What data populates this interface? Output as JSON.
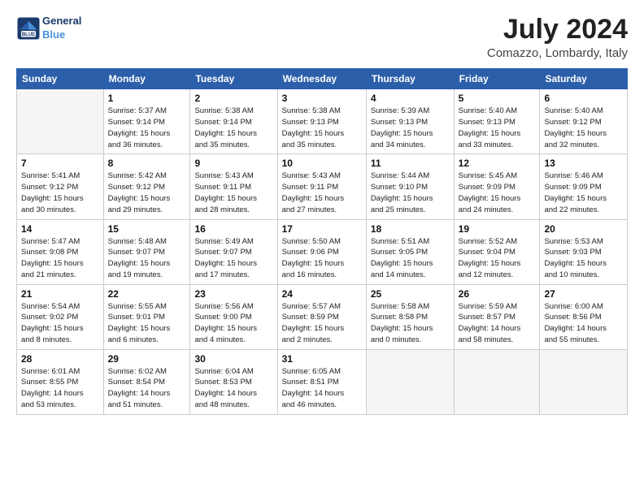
{
  "header": {
    "logo_line1": "General",
    "logo_line2": "Blue",
    "month": "July 2024",
    "location": "Comazzo, Lombardy, Italy"
  },
  "days_of_week": [
    "Sunday",
    "Monday",
    "Tuesday",
    "Wednesday",
    "Thursday",
    "Friday",
    "Saturday"
  ],
  "weeks": [
    [
      {
        "num": "",
        "info": ""
      },
      {
        "num": "1",
        "info": "Sunrise: 5:37 AM\nSunset: 9:14 PM\nDaylight: 15 hours\nand 36 minutes."
      },
      {
        "num": "2",
        "info": "Sunrise: 5:38 AM\nSunset: 9:14 PM\nDaylight: 15 hours\nand 35 minutes."
      },
      {
        "num": "3",
        "info": "Sunrise: 5:38 AM\nSunset: 9:13 PM\nDaylight: 15 hours\nand 35 minutes."
      },
      {
        "num": "4",
        "info": "Sunrise: 5:39 AM\nSunset: 9:13 PM\nDaylight: 15 hours\nand 34 minutes."
      },
      {
        "num": "5",
        "info": "Sunrise: 5:40 AM\nSunset: 9:13 PM\nDaylight: 15 hours\nand 33 minutes."
      },
      {
        "num": "6",
        "info": "Sunrise: 5:40 AM\nSunset: 9:12 PM\nDaylight: 15 hours\nand 32 minutes."
      }
    ],
    [
      {
        "num": "7",
        "info": "Sunrise: 5:41 AM\nSunset: 9:12 PM\nDaylight: 15 hours\nand 30 minutes."
      },
      {
        "num": "8",
        "info": "Sunrise: 5:42 AM\nSunset: 9:12 PM\nDaylight: 15 hours\nand 29 minutes."
      },
      {
        "num": "9",
        "info": "Sunrise: 5:43 AM\nSunset: 9:11 PM\nDaylight: 15 hours\nand 28 minutes."
      },
      {
        "num": "10",
        "info": "Sunrise: 5:43 AM\nSunset: 9:11 PM\nDaylight: 15 hours\nand 27 minutes."
      },
      {
        "num": "11",
        "info": "Sunrise: 5:44 AM\nSunset: 9:10 PM\nDaylight: 15 hours\nand 25 minutes."
      },
      {
        "num": "12",
        "info": "Sunrise: 5:45 AM\nSunset: 9:09 PM\nDaylight: 15 hours\nand 24 minutes."
      },
      {
        "num": "13",
        "info": "Sunrise: 5:46 AM\nSunset: 9:09 PM\nDaylight: 15 hours\nand 22 minutes."
      }
    ],
    [
      {
        "num": "14",
        "info": "Sunrise: 5:47 AM\nSunset: 9:08 PM\nDaylight: 15 hours\nand 21 minutes."
      },
      {
        "num": "15",
        "info": "Sunrise: 5:48 AM\nSunset: 9:07 PM\nDaylight: 15 hours\nand 19 minutes."
      },
      {
        "num": "16",
        "info": "Sunrise: 5:49 AM\nSunset: 9:07 PM\nDaylight: 15 hours\nand 17 minutes."
      },
      {
        "num": "17",
        "info": "Sunrise: 5:50 AM\nSunset: 9:06 PM\nDaylight: 15 hours\nand 16 minutes."
      },
      {
        "num": "18",
        "info": "Sunrise: 5:51 AM\nSunset: 9:05 PM\nDaylight: 15 hours\nand 14 minutes."
      },
      {
        "num": "19",
        "info": "Sunrise: 5:52 AM\nSunset: 9:04 PM\nDaylight: 15 hours\nand 12 minutes."
      },
      {
        "num": "20",
        "info": "Sunrise: 5:53 AM\nSunset: 9:03 PM\nDaylight: 15 hours\nand 10 minutes."
      }
    ],
    [
      {
        "num": "21",
        "info": "Sunrise: 5:54 AM\nSunset: 9:02 PM\nDaylight: 15 hours\nand 8 minutes."
      },
      {
        "num": "22",
        "info": "Sunrise: 5:55 AM\nSunset: 9:01 PM\nDaylight: 15 hours\nand 6 minutes."
      },
      {
        "num": "23",
        "info": "Sunrise: 5:56 AM\nSunset: 9:00 PM\nDaylight: 15 hours\nand 4 minutes."
      },
      {
        "num": "24",
        "info": "Sunrise: 5:57 AM\nSunset: 8:59 PM\nDaylight: 15 hours\nand 2 minutes."
      },
      {
        "num": "25",
        "info": "Sunrise: 5:58 AM\nSunset: 8:58 PM\nDaylight: 15 hours\nand 0 minutes."
      },
      {
        "num": "26",
        "info": "Sunrise: 5:59 AM\nSunset: 8:57 PM\nDaylight: 14 hours\nand 58 minutes."
      },
      {
        "num": "27",
        "info": "Sunrise: 6:00 AM\nSunset: 8:56 PM\nDaylight: 14 hours\nand 55 minutes."
      }
    ],
    [
      {
        "num": "28",
        "info": "Sunrise: 6:01 AM\nSunset: 8:55 PM\nDaylight: 14 hours\nand 53 minutes."
      },
      {
        "num": "29",
        "info": "Sunrise: 6:02 AM\nSunset: 8:54 PM\nDaylight: 14 hours\nand 51 minutes."
      },
      {
        "num": "30",
        "info": "Sunrise: 6:04 AM\nSunset: 8:53 PM\nDaylight: 14 hours\nand 48 minutes."
      },
      {
        "num": "31",
        "info": "Sunrise: 6:05 AM\nSunset: 8:51 PM\nDaylight: 14 hours\nand 46 minutes."
      },
      {
        "num": "",
        "info": ""
      },
      {
        "num": "",
        "info": ""
      },
      {
        "num": "",
        "info": ""
      }
    ]
  ]
}
